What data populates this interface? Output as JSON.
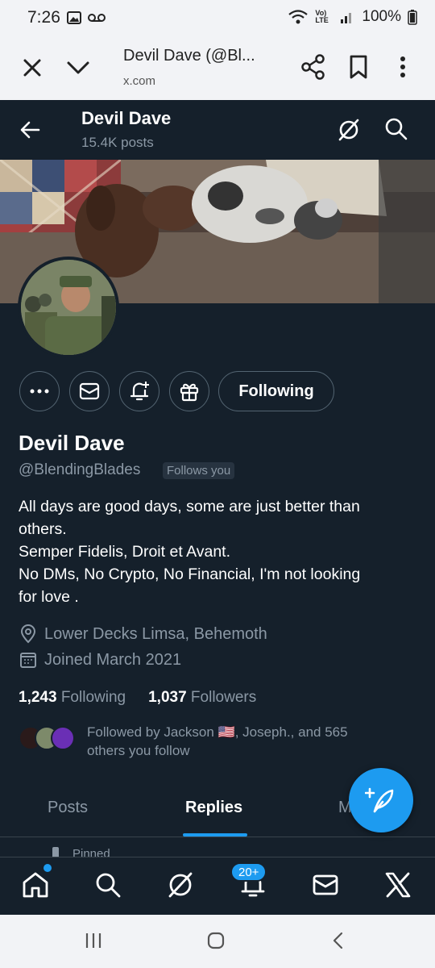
{
  "status_bar": {
    "time": "7:26",
    "battery": "100%",
    "network": "Vo) LTE"
  },
  "browser": {
    "title": "Devil Dave (@Bl...",
    "url": "x.com"
  },
  "header": {
    "name": "Devil Dave",
    "posts": "15.4K posts"
  },
  "profile": {
    "name": "Devil Dave",
    "handle": "@BlendingBlades",
    "follows_you": "Follows you",
    "following_button": "Following",
    "bio": [
      "All days are good days, some are just better than",
      "others.",
      "Semper Fidelis, Droit et Avant.",
      "No DMs, No Crypto, No Financial, I'm not looking",
      "for love ."
    ],
    "location": "Lower Decks Limsa, Behemoth",
    "joined": "Joined March 2021",
    "following_count": "1,243",
    "following_label": "Following",
    "followers_count": "1,037",
    "followers_label": "Followers",
    "followed_by_line1": "Followed by Jackson 🇺🇸, Joseph., and 565",
    "followed_by_line2": "others you follow"
  },
  "tabs": [
    {
      "label": "Posts"
    },
    {
      "label": "Replies"
    },
    {
      "label": "M"
    }
  ],
  "pinned_label": "Pinned",
  "bottom_nav": {
    "notification_badge": "20+"
  },
  "colors": {
    "background": "#15202b",
    "accent": "#1d9bf0",
    "muted_text": "#8b98a5",
    "border": "#536471"
  }
}
